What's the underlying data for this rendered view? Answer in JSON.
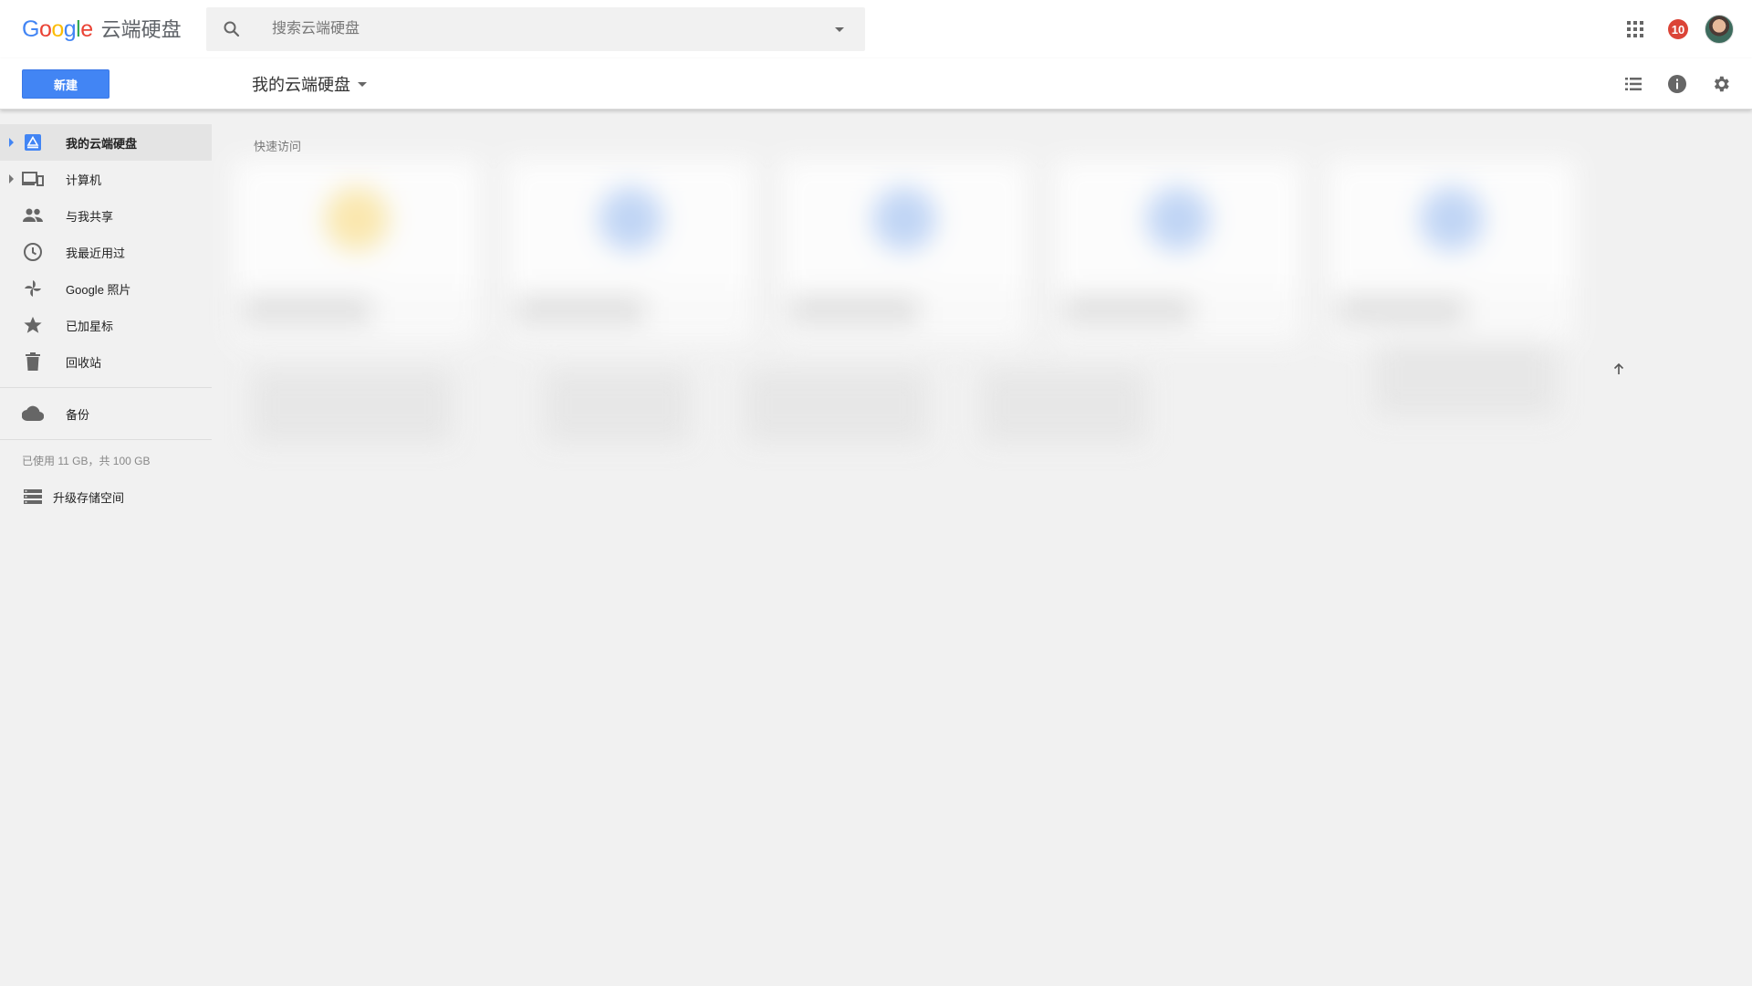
{
  "app": {
    "logo_letters": [
      "G",
      "o",
      "o",
      "g",
      "l",
      "e"
    ],
    "product_name": "云端硬盘"
  },
  "search": {
    "placeholder": "搜索云端硬盘",
    "value": ""
  },
  "header": {
    "notification_count": "10",
    "icons": [
      "apps-grid-icon",
      "notification-badge",
      "account-avatar"
    ]
  },
  "toolbar": {
    "new_label": "新建",
    "breadcrumb_label": "我的云端硬盘",
    "right_icons": [
      "list-view-icon",
      "info-icon",
      "settings-icon"
    ]
  },
  "sidebar": {
    "items": [
      {
        "label": "我的云端硬盘",
        "icon": "drive-icon",
        "active": true,
        "expandable": true
      },
      {
        "label": "计算机",
        "icon": "computers-icon",
        "active": false,
        "expandable": true
      },
      {
        "label": "与我共享",
        "icon": "shared-people-icon",
        "active": false,
        "expandable": false
      },
      {
        "label": "我最近用过",
        "icon": "clock-icon",
        "active": false,
        "expandable": false
      },
      {
        "label": "Google 照片",
        "icon": "pinwheel-icon",
        "active": false,
        "expandable": false
      },
      {
        "label": "已加星标",
        "icon": "star-icon",
        "active": false,
        "expandable": false
      },
      {
        "label": "回收站",
        "icon": "trash-icon",
        "active": false,
        "expandable": false
      }
    ],
    "backup_label": "备份",
    "storage_text": "已使用 11 GB，共 100 GB",
    "upgrade_label": "升级存储空间"
  },
  "main": {
    "quick_access_title": "快速访问"
  },
  "colors": {
    "primary": "#4285f4",
    "badge": "#db4437",
    "background": "#f1f1f1",
    "active_nav": "#e4e4e4"
  }
}
